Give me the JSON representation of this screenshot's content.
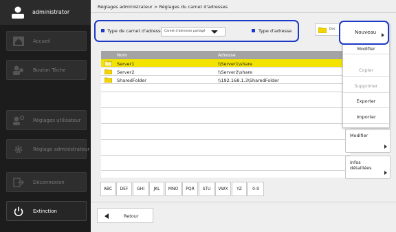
{
  "sidebar": {
    "user": "administrator",
    "items": [
      {
        "label": "Accueil",
        "icon": "home-icon"
      },
      {
        "label": "Bouton Tâche",
        "icon": "task-button-icon"
      },
      {
        "label": "Réglages utilisateur",
        "icon": "user-settings-icon"
      },
      {
        "label": "Réglage administrateur",
        "icon": "admin-settings-icon"
      },
      {
        "label": "Déconnexion",
        "icon": "logout-icon"
      },
      {
        "label": "Extinction",
        "icon": "power-icon"
      }
    ]
  },
  "breadcrumb": "Réglages administrateur > Réglages du carnet d'adresses",
  "filters": {
    "book_type_label": "Type de carnet d'adresses",
    "book_type_value": "Carnet d'adresses partagé",
    "address_type_label": "Type d'adresse",
    "address_type_value": "Dos"
  },
  "table": {
    "columns": [
      "Nom",
      "Adresse"
    ],
    "rows": [
      {
        "name": "Server1",
        "address": "\\\\Server1\\share",
        "selected": true
      },
      {
        "name": "Server2",
        "address": "\\\\Server2\\share",
        "selected": false
      },
      {
        "name": "SharedFolder",
        "address": "\\\\192.168.1.3\\SharedFolder",
        "selected": false
      }
    ]
  },
  "alpha_tabs": [
    "ABC",
    "DEF",
    "GHI",
    "JKL",
    "MNO",
    "PQR",
    "STU",
    "VWX",
    "YZ",
    "0-9"
  ],
  "menu": {
    "new": "Nouveau",
    "modify_partial": "Modifier",
    "copy": "Copier",
    "delete": "Supprimer",
    "export": "Exporter",
    "import": "Importer"
  },
  "actions": {
    "modify": "Modifier",
    "details_line1": "Infos",
    "details_line2": "détaillées"
  },
  "back": "Retour",
  "colors": {
    "accent": "#1a38c8",
    "selected_row": "#f2e300",
    "header": "#a3a3a3"
  }
}
